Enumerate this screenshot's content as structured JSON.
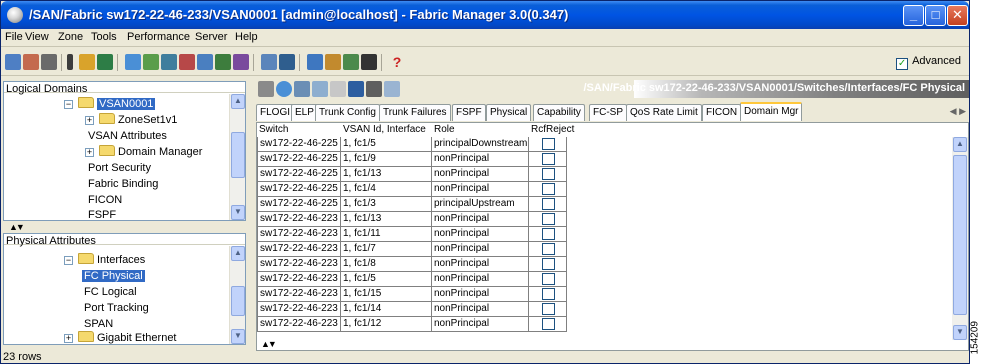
{
  "window": {
    "title": "/SAN/Fabric sw172-22-46-233/VSAN0001 [admin@localhost] - Fabric Manager 3.0(0.347)"
  },
  "menu": [
    "File",
    "View",
    "Zone",
    "Tools",
    "Performance",
    "Server",
    "Help"
  ],
  "toolbar": {
    "advanced_label": "Advanced",
    "advanced_checked": true
  },
  "logical_domains": {
    "title": "Logical Domains",
    "items": [
      {
        "label": "VSAN0001",
        "selected": true
      },
      {
        "label": "ZoneSet1v1"
      },
      {
        "label": "VSAN Attributes"
      },
      {
        "label": "Domain Manager"
      },
      {
        "label": "Port Security"
      },
      {
        "label": "Fabric Binding"
      },
      {
        "label": "FICON"
      },
      {
        "label": "FSPF"
      }
    ]
  },
  "physical_attributes": {
    "title": "Physical Attributes",
    "items": [
      {
        "label": "Interfaces"
      },
      {
        "label": "FC Physical",
        "selected": true
      },
      {
        "label": "FC Logical"
      },
      {
        "label": "Port Tracking"
      },
      {
        "label": "SPAN"
      },
      {
        "label": "Gigabit Ethernet"
      }
    ]
  },
  "path": "/SAN/Fabric sw172-22-46-233/VSAN0001/Switches/Interfaces/FC Physical",
  "tabs": [
    "FLOGI",
    "ELP",
    "Trunk Config",
    "Trunk Failures",
    "FSPF",
    "Physical",
    "Capability",
    "FC-SP",
    "QoS Rate Limit",
    "FICON",
    "Domain Mgr"
  ],
  "active_tab": "Domain Mgr",
  "table": {
    "headers": [
      "Switch",
      "VSAN Id, Interface",
      "Role",
      "RcfReject"
    ],
    "rows": [
      [
        "sw172-22-46-225",
        "1, fc1/5",
        "principalDownstream"
      ],
      [
        "sw172-22-46-225",
        "1, fc1/9",
        "nonPrincipal"
      ],
      [
        "sw172-22-46-225",
        "1, fc1/13",
        "nonPrincipal"
      ],
      [
        "sw172-22-46-225",
        "1, fc1/4",
        "nonPrincipal"
      ],
      [
        "sw172-22-46-225",
        "1, fc1/3",
        "principalUpstream"
      ],
      [
        "sw172-22-46-223",
        "1, fc1/13",
        "nonPrincipal"
      ],
      [
        "sw172-22-46-223",
        "1, fc1/11",
        "nonPrincipal"
      ],
      [
        "sw172-22-46-223",
        "1, fc1/7",
        "nonPrincipal"
      ],
      [
        "sw172-22-46-223",
        "1, fc1/8",
        "nonPrincipal"
      ],
      [
        "sw172-22-46-223",
        "1, fc1/5",
        "nonPrincipal"
      ],
      [
        "sw172-22-46-223",
        "1, fc1/15",
        "nonPrincipal"
      ],
      [
        "sw172-22-46-223",
        "1, fc1/14",
        "nonPrincipal"
      ],
      [
        "sw172-22-46-223",
        "1, fc1/12",
        "nonPrincipal"
      ]
    ]
  },
  "status": "23 rows",
  "side_code": "154209"
}
